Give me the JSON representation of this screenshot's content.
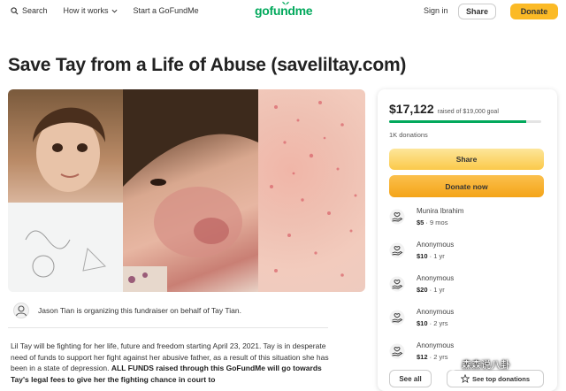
{
  "header": {
    "search_label": "Search",
    "how_it_works_label": "How it works",
    "start_label": "Start a GoFundMe",
    "logo_text": "gofundme",
    "signin_label": "Sign in",
    "share_label": "Share",
    "donate_label": "Donate",
    "brand_color": "#02a95c",
    "donate_color": "#fbba26"
  },
  "campaign": {
    "title": "Save Tay from a Life of Abuse (saveliltay.com)",
    "organizer_text": "Jason Tian is organizing this fundraiser on behalf of Tay Tian.",
    "story_part1": "Lil Tay will be fighting for her life, future and freedom starting April 23, 2021. Tay is in desperate need of funds to support her fight against her abusive father, as a result of this situation she has been in a state of depression. ",
    "story_bold": "ALL FUNDS raised through this GoFundMe will go towards Tay's legal fees to give her the fighting chance in court to"
  },
  "donation_card": {
    "raised": "$17,122",
    "goal_text": "raised of $19,000 goal",
    "progress_fraction": 0.9,
    "donations_count": "1K donations",
    "share_label": "Share",
    "donate_now_label": "Donate now",
    "donors": [
      {
        "name": "Munira Ibrahim",
        "amount": "$5",
        "ago": "9 mos"
      },
      {
        "name": "Anonymous",
        "amount": "$10",
        "ago": "1 yr"
      },
      {
        "name": "Anonymous",
        "amount": "$20",
        "ago": "1 yr"
      },
      {
        "name": "Anonymous",
        "amount": "$10",
        "ago": "2 yrs"
      },
      {
        "name": "Anonymous",
        "amount": "$12",
        "ago": "2 yrs"
      }
    ],
    "see_all_label": "See all",
    "see_top_label": "See top donations"
  },
  "watermark": {
    "text": "森森说八卦"
  }
}
